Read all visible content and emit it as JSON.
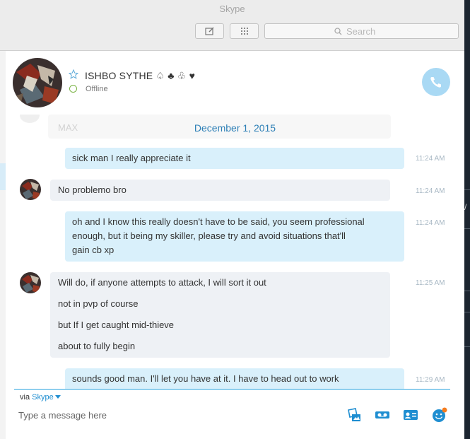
{
  "window": {
    "title": "Skype"
  },
  "toolbar": {
    "search_placeholder": "Search"
  },
  "contact": {
    "name": "ISHBO SYTHE ♤ ♣ ♧ ♥",
    "status": "Offline"
  },
  "chat": {
    "ghost_text": "MAX",
    "date": "December 1, 2015",
    "messages": [
      {
        "direction": "out",
        "lines": [
          "sick man I really appreciate it"
        ],
        "time": "11:24 AM"
      },
      {
        "direction": "in",
        "lines": [
          "No problemo bro"
        ],
        "time": "11:24 AM"
      },
      {
        "direction": "out",
        "lines": [
          "oh and I know this really doesn't have to be said, you seem professional",
          "enough, but it being my skiller, please try and avoid situations that'll",
          "gain cb xp"
        ],
        "time": "11:24 AM"
      },
      {
        "direction": "in",
        "lines": [
          "Will do, if anyone attempts to attack, I will sort it out",
          "not in pvp of course",
          "but If I get caught mid-thieve",
          "about to fully begin"
        ],
        "time": "11:25 AM"
      },
      {
        "direction": "out",
        "lines": [
          "sounds good man. I'll let you have at it. I have to head out to work"
        ],
        "time": "11:29 AM"
      }
    ]
  },
  "composer": {
    "via_label": "via",
    "via_service": "Skype",
    "placeholder": "Type a message here"
  },
  "background": {
    "right_edge_text": "/"
  },
  "colors": {
    "accent": "#2aa4df",
    "outgoing_bubble": "#d9f0fb",
    "incoming_bubble": "#eef1f5",
    "date": "#2d7fb6",
    "online_ring": "#7ab344"
  }
}
